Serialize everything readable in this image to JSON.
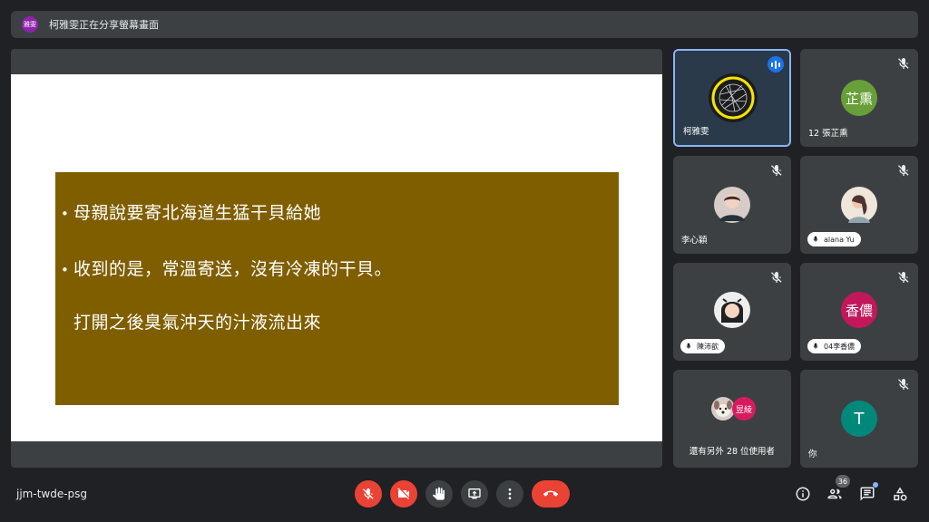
{
  "top_bar": {
    "presenter_avatar_text": "雅雯",
    "presenting_text": "柯雅雯正在分享螢幕畫面"
  },
  "slide": {
    "bullets": [
      "母親說要寄北海道生猛干貝給她",
      "收到的是，常溫寄送，沒有冷凍的干貝。",
      "打開之後臭氣沖天的汁液流出來"
    ],
    "bullet_char": "•",
    "box_color": "#7f5e00"
  },
  "participants": [
    {
      "name": "柯雅雯",
      "speaking": true
    },
    {
      "name": "12 張芷熏",
      "avatar_text": "芷熏",
      "avatar_color": "#689f38"
    },
    {
      "name": "李心穎"
    },
    {
      "name": "alana Yu"
    },
    {
      "name": "陳沛歆"
    },
    {
      "name": "04李香儂",
      "avatar_text": "香儂",
      "avatar_color": "#c2185b"
    },
    {
      "more_text": "還有另外 28 位使用者",
      "avatar_text": "昱綾",
      "avatar_color": "#d81b60"
    },
    {
      "name": "你",
      "avatar_text": "T",
      "avatar_color": "#00897b"
    }
  ],
  "bottom_bar": {
    "meeting_code": "jjm-twde-psg",
    "people_count": "36"
  },
  "colors": {
    "background": "#202124",
    "tile": "#3c4043",
    "danger": "#ea4335",
    "active_border": "#8ab4f8"
  }
}
